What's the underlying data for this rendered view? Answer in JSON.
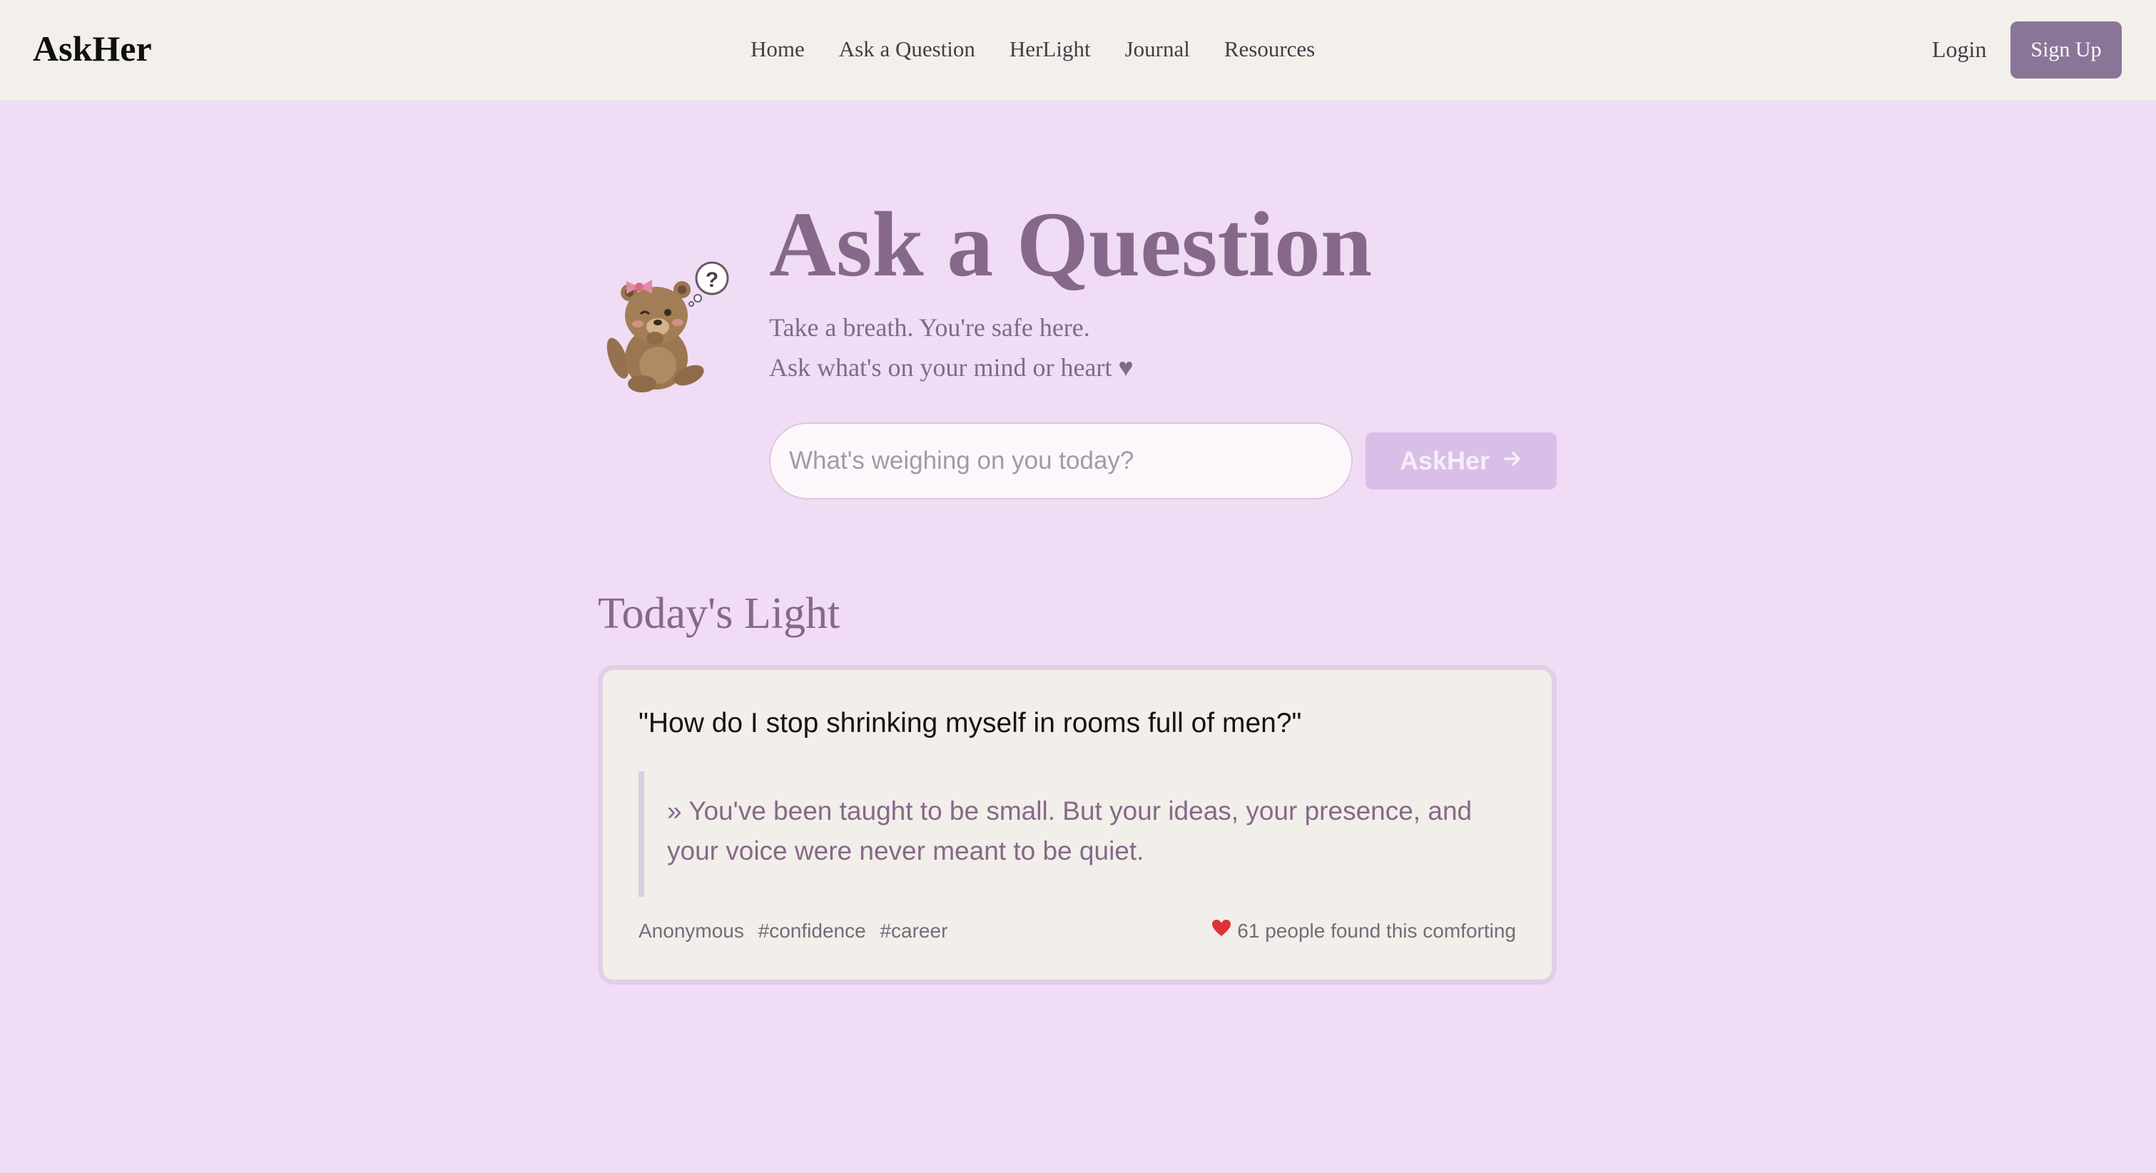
{
  "header": {
    "logo": "AskHer",
    "nav": [
      "Home",
      "Ask a Question",
      "HerLight",
      "Journal",
      "Resources"
    ],
    "login_label": "Login",
    "signup_label": "Sign Up"
  },
  "hero": {
    "title": "Ask a Question",
    "subtitle_line1": "Take a breath. You're safe here.",
    "subtitle_line2": "Ask what's on your mind or heart ♥",
    "mascot_icon": "thinking-bear-icon",
    "search_placeholder": "What's weighing on you today?",
    "search_value": "",
    "ask_button_label": "AskHer",
    "ask_button_icon": "arrow-right-icon"
  },
  "todays_light": {
    "heading": "Today's Light",
    "question": "\"How do I stop shrinking myself in rooms full of men?\"",
    "answer": "» You've been taught to be small. But your ideas, your presence, and your voice were never meant to be quiet.",
    "author": "Anonymous",
    "tags": [
      "#confidence",
      "#career"
    ],
    "comfort_icon": "heart-icon",
    "comfort_text": "61 people found this comforting"
  },
  "colors": {
    "page_background": "#f0dcf4",
    "header_background": "#f3efea",
    "accent": "#86698a",
    "signup_button": "#8a7598",
    "ask_button": "#d9bfe7",
    "card_background": "#f2eee9",
    "card_border": "#e2cfe7",
    "heart": "#e0323b"
  }
}
